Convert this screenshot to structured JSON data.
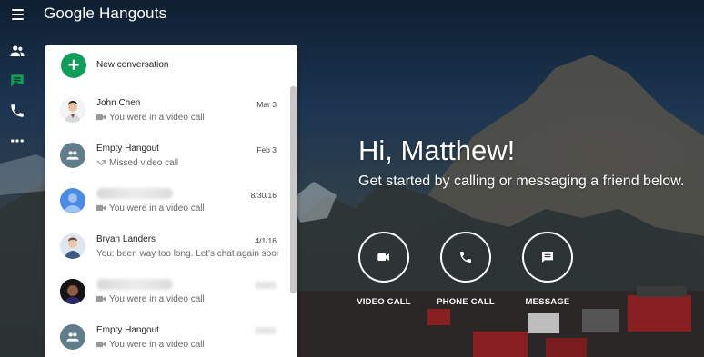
{
  "app": {
    "title": "Google Hangouts"
  },
  "rail": {
    "items": [
      {
        "icon": "contacts-icon",
        "color": "#ffffff"
      },
      {
        "icon": "chat-icon",
        "color": "#0f9d58"
      },
      {
        "icon": "phone-icon",
        "color": "#ffffff"
      },
      {
        "icon": "more-horiz-icon",
        "color": "#ffffff"
      }
    ]
  },
  "panel": {
    "new_conversation_label": "New conversation",
    "conversations": [
      {
        "name": "John Chen",
        "date": "Mar 3",
        "snippet": "You were in a video call",
        "snippet_icon": "video-icon"
      },
      {
        "name": "Empty Hangout",
        "date": "Feb 3",
        "snippet": "Missed video call",
        "snippet_icon": "missed-call-icon"
      },
      {
        "name": "",
        "date": "8/30/16",
        "snippet": "You were in a video call",
        "snippet_icon": "video-icon"
      },
      {
        "name": "Bryan Landers",
        "date": "4/1/16",
        "snippet": "You: been way too long. Let's chat again soon-",
        "snippet_icon": ""
      },
      {
        "name": "",
        "date": "",
        "snippet": "You were in a video call",
        "snippet_icon": "video-icon"
      },
      {
        "name": "Empty Hangout",
        "date": "",
        "snippet": "You were in a video call",
        "snippet_icon": "video-icon"
      }
    ]
  },
  "greeting": {
    "title": "Hi, Matthew!",
    "subtitle": "Get started by calling or messaging a friend below."
  },
  "actions": [
    {
      "label": "VIDEO CALL",
      "icon": "video-icon"
    },
    {
      "label": "PHONE CALL",
      "icon": "phone-icon"
    },
    {
      "label": "MESSAGE",
      "icon": "message-icon"
    }
  ],
  "colors": {
    "accent_green": "#0f9d58"
  }
}
